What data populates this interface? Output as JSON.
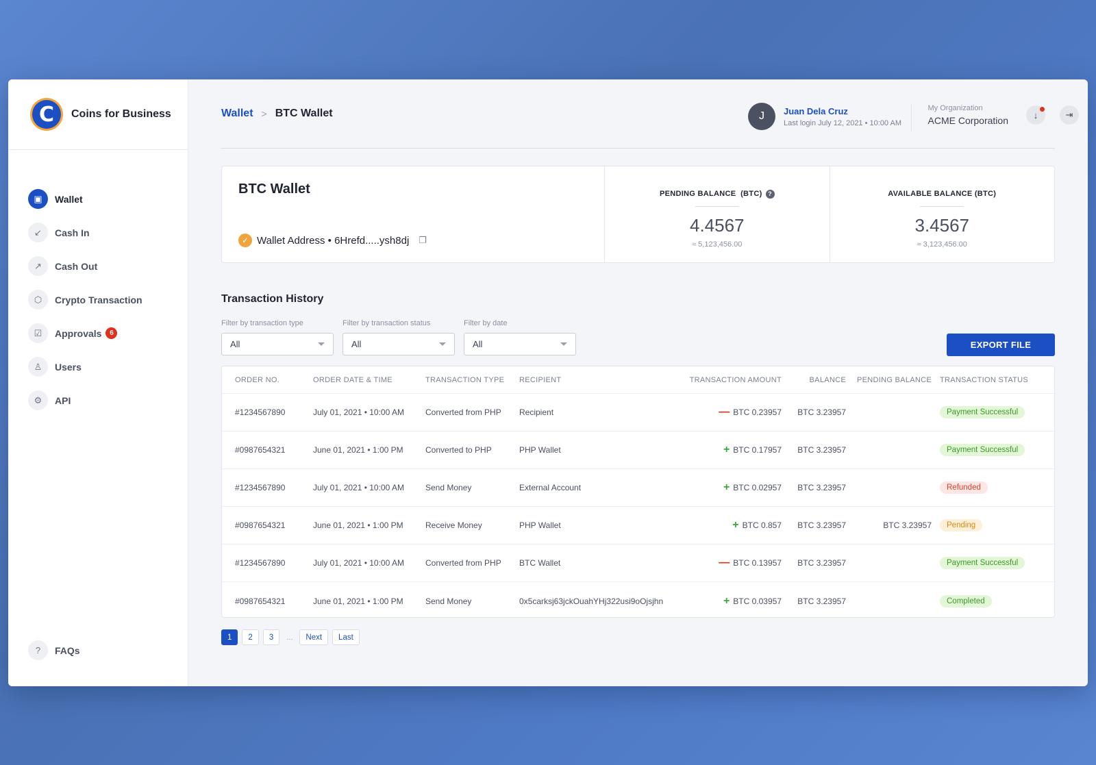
{
  "brand": {
    "name": "Coins for Business",
    "logo_letter": "C"
  },
  "sidebar": {
    "items": [
      {
        "label": "Wallet",
        "icon": "wallet-icon",
        "glyph": "▣",
        "active": true
      },
      {
        "label": "Cash In",
        "icon": "cash-in-icon",
        "glyph": "↙"
      },
      {
        "label": "Cash Out",
        "icon": "cash-out-icon",
        "glyph": "↗"
      },
      {
        "label": "Crypto Transaction",
        "icon": "cube-icon",
        "glyph": "⬡"
      },
      {
        "label": "Approvals",
        "icon": "checkbox-icon",
        "glyph": "☑",
        "badge": "6"
      },
      {
        "label": "Users",
        "icon": "user-icon",
        "glyph": "♙"
      },
      {
        "label": "API",
        "icon": "gear-icon",
        "glyph": "⚙"
      }
    ],
    "faq": {
      "label": "FAQs",
      "glyph": "?"
    }
  },
  "header": {
    "breadcrumb_root": "Wallet",
    "breadcrumb_sep": ">",
    "breadcrumb_current": "BTC Wallet",
    "user": {
      "initial": "J",
      "name": "Juan Dela Cruz",
      "last_login": "Last login July 12, 2021 • 10:00 AM"
    },
    "org": {
      "label": "My Organization",
      "name": "ACME Corporation"
    },
    "download_glyph": "↓",
    "logout_glyph": "⇥"
  },
  "wallet": {
    "title": "BTC Wallet",
    "address_label": "Wallet Address • 6Hrefd.....ysh8dj",
    "check_glyph": "✓",
    "copy_glyph": "❐",
    "pending": {
      "label": "PENDING BALANCE  (BTC)",
      "value": "4.4567",
      "approx": "≈ 5,123,456.00",
      "help_glyph": "?"
    },
    "available": {
      "label": "AVAILABLE BALANCE (BTC)",
      "value": "3.4567",
      "approx": "≈ 3,123,456.00"
    }
  },
  "history": {
    "title": "Transaction History",
    "filters": [
      {
        "label": "Filter by transaction type",
        "value": "All"
      },
      {
        "label": "Filter by transaction status",
        "value": "All"
      },
      {
        "label": "Filter by date",
        "value": "All"
      }
    ],
    "export_label": "EXPORT FILE",
    "columns": {
      "order": "ORDER NO.",
      "date": "ORDER DATE & TIME",
      "type": "TRANSACTION TYPE",
      "recipient": "RECIPIENT",
      "amount": "TRANSACTION AMOUNT",
      "balance": "BALANCE",
      "pending": "PENDING BALANCE",
      "status": "TRANSACTION STATUS"
    },
    "rows": [
      {
        "order": "#1234567890",
        "date": "July 01, 2021 • 10:00 AM",
        "type": "Converted from PHP",
        "recipient": "Recipient",
        "sign": "—",
        "sign_kind": "minus",
        "amount": "BTC 0.23957",
        "balance": "BTC 3.23957",
        "pending": "",
        "status": "Payment Successful",
        "status_kind": "success"
      },
      {
        "order": "#0987654321",
        "date": "June 01, 2021 • 1:00 PM",
        "type": "Converted to PHP",
        "recipient": "PHP Wallet",
        "sign": "+",
        "sign_kind": "plus",
        "amount": "BTC 0.17957",
        "balance": "BTC 3.23957",
        "pending": "",
        "status": "Payment Successful",
        "status_kind": "success"
      },
      {
        "order": "#1234567890",
        "date": "July 01, 2021 • 10:00 AM",
        "type": "Send Money",
        "recipient": "External Account",
        "sign": "+",
        "sign_kind": "plus",
        "amount": "BTC 0.02957",
        "balance": "BTC 3.23957",
        "pending": "",
        "status": "Refunded",
        "status_kind": "refunded"
      },
      {
        "order": "#0987654321",
        "date": "June 01, 2021 • 1:00 PM",
        "type": "Receive Money",
        "recipient": "PHP Wallet",
        "sign": "+",
        "sign_kind": "plus",
        "amount": "BTC 0.857",
        "balance": "BTC 3.23957",
        "pending": "BTC 3.23957",
        "status": "Pending",
        "status_kind": "pending"
      },
      {
        "order": "#1234567890",
        "date": "July 01, 2021 • 10:00 AM",
        "type": "Converted from PHP",
        "recipient": "BTC Wallet",
        "sign": "—",
        "sign_kind": "minus",
        "amount": "BTC 0.13957",
        "balance": "BTC 3.23957",
        "pending": "",
        "status": "Payment Successful",
        "status_kind": "success"
      },
      {
        "order": "#0987654321",
        "date": "June 01, 2021 • 1:00 PM",
        "type": "Send Money",
        "recipient": "0x5carksj63jckOuahYHj322usi9oOjsjhn",
        "sign": "+",
        "sign_kind": "plus",
        "amount": "BTC 0.03957",
        "balance": "BTC 3.23957",
        "pending": "",
        "status": "Completed",
        "status_kind": "success"
      }
    ],
    "pagination": {
      "pages": [
        "1",
        "2",
        "3"
      ],
      "current": "1",
      "ellipsis": "...",
      "next": "Next",
      "last": "Last"
    }
  }
}
